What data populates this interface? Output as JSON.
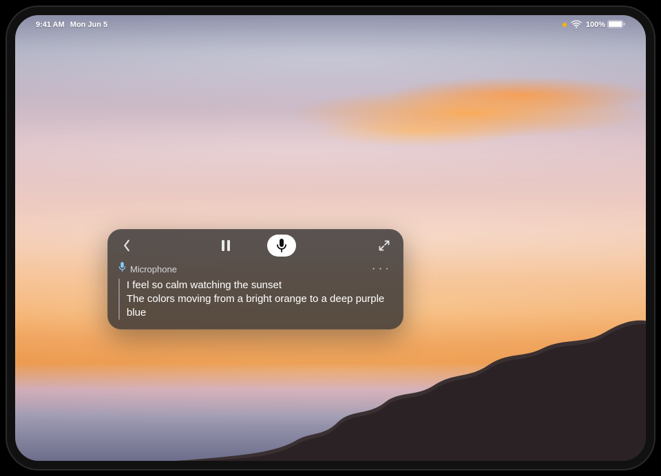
{
  "status": {
    "time": "9:41 AM",
    "date": "Mon Jun 5",
    "battery_pct": "100%",
    "mic_active_dot_color": "#ffb300"
  },
  "panel": {
    "source_label": "Microphone",
    "caption_line1": "I feel so calm watching the sunset",
    "caption_line2": "The colors moving from a bright orange to a deep purple blue"
  },
  "icons": {
    "back": "chevron-left",
    "pause": "pause",
    "mic": "microphone",
    "expand": "expand",
    "more": "ellipsis"
  }
}
